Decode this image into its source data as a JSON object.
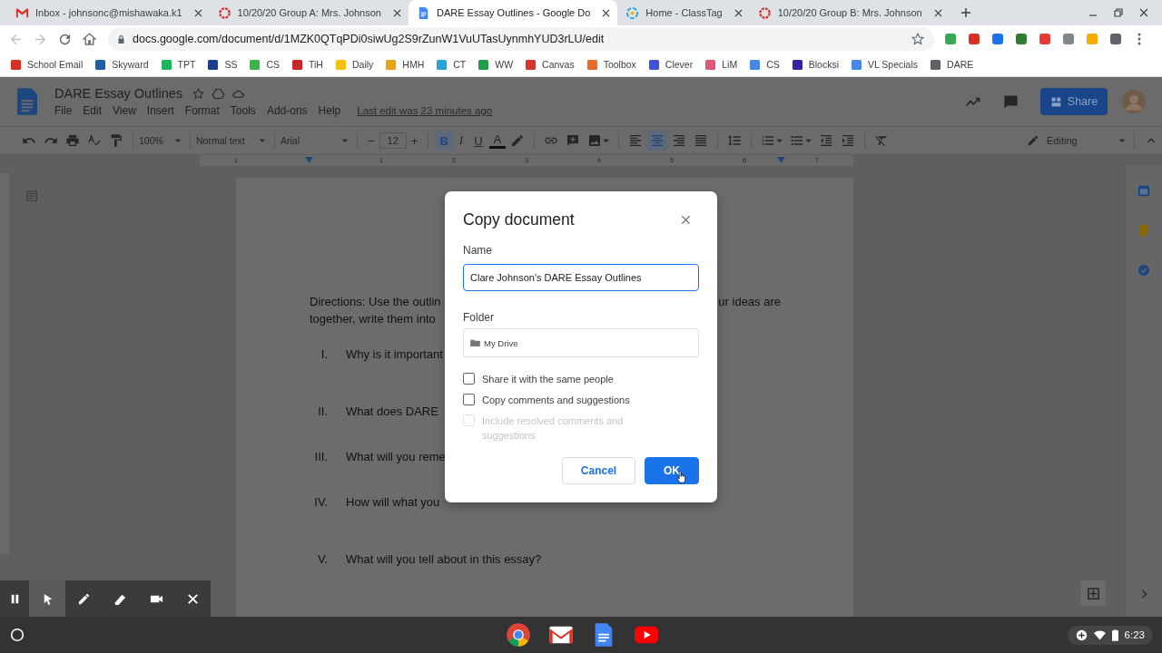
{
  "browser": {
    "tabs": [
      {
        "title": "Inbox - johnsonc@mishawaka.k1",
        "kind": "mail",
        "selected": false
      },
      {
        "title": "10/20/20 Group A: Mrs. Johnson",
        "kind": "ring",
        "selected": false
      },
      {
        "title": "DARE Essay Outlines - Google Do",
        "kind": "doc",
        "selected": true
      },
      {
        "title": "Home - ClassTag",
        "kind": "swirl",
        "selected": false
      },
      {
        "title": "10/20/20 Group B: Mrs. Johnson",
        "kind": "ring",
        "selected": false
      }
    ],
    "url": "docs.google.com/document/d/1MZK0QTqPDi0siwUg2S9rZunW1VuUTasUynmhYUD3rLU/edit",
    "bookmarks": [
      {
        "label": "School Email",
        "color": "#d93025"
      },
      {
        "label": "Skyward",
        "color": "#1f5fa8"
      },
      {
        "label": "TPT",
        "color": "#1fb35a"
      },
      {
        "label": "SS",
        "color": "#1a3d8f"
      },
      {
        "label": "CS",
        "color": "#3bb54a"
      },
      {
        "label": "TiH",
        "color": "#c62828"
      },
      {
        "label": "Daily",
        "color": "#f4c20d"
      },
      {
        "label": "HMH",
        "color": "#e8a317"
      },
      {
        "label": "CT",
        "color": "#29a3d8"
      },
      {
        "label": "WW",
        "color": "#1e9e4a"
      },
      {
        "label": "Canvas",
        "color": "#d5342b"
      },
      {
        "label": "Toolbox",
        "color": "#e86b2a"
      },
      {
        "label": "Clever",
        "color": "#4054d6"
      },
      {
        "label": "LiM",
        "color": "#e0577a"
      },
      {
        "label": "CS",
        "color": "#4a86e8"
      },
      {
        "label": "Blocksi",
        "color": "#3c1fa3"
      },
      {
        "label": "VL Specials",
        "color": "#4a86e8"
      },
      {
        "label": "DARE",
        "color": "#5f6368"
      }
    ]
  },
  "docs": {
    "title": "DARE Essay Outlines",
    "menus": [
      "File",
      "Edit",
      "View",
      "Insert",
      "Format",
      "Tools",
      "Add-ons",
      "Help"
    ],
    "last_edit": "Last edit was 23 minutes ago",
    "share": "Share",
    "toolbar": {
      "zoom": "100%",
      "style": "Normal text",
      "font": "Arial",
      "decrease": "−",
      "size": "12",
      "increase": "+",
      "format": [
        {
          "label": "B",
          "selected": true
        },
        {
          "label": "I",
          "selected": false
        },
        {
          "label": "U",
          "selected": false
        },
        {
          "label": "A",
          "selected": false
        }
      ],
      "align": [
        {
          "kind": "left",
          "selected": false
        },
        {
          "kind": "center",
          "selected": true
        },
        {
          "kind": "right",
          "selected": false
        },
        {
          "kind": "justify",
          "selected": false
        }
      ],
      "mode": "Editing"
    },
    "ruler": [
      "1",
      "1",
      "2",
      "3",
      "4",
      "5",
      "6",
      "7"
    ],
    "document": {
      "directions": [
        {
          "left": "Directions: Use the outlin",
          "right": "ur ideas are"
        },
        {
          "left": "together, write them into"
        }
      ],
      "outline": [
        {
          "numeral": "I.",
          "text": "Why is it important"
        },
        {
          "numeral": "II.",
          "text": "What does DARE"
        },
        {
          "numeral": "III.",
          "text": "What will you reme"
        },
        {
          "numeral": "IV.",
          "text": "How will what you"
        },
        {
          "numeral": "V.",
          "text": "What will you tell about in this essay?"
        }
      ]
    }
  },
  "dialog": {
    "title": "Copy document",
    "name_label": "Name",
    "name_value": "Clare Johnson's DARE Essay Outlines",
    "folder_label": "Folder",
    "folder": "My Drive",
    "options": [
      {
        "label": "Share it with the same people",
        "checked": false,
        "disabled": false
      },
      {
        "label": "Copy comments and suggestions",
        "checked": false,
        "disabled": false
      },
      {
        "label": "Include resolved comments and suggestions",
        "checked": false,
        "disabled": true
      }
    ],
    "buttons": [
      {
        "label": "Cancel",
        "kind": "secondary"
      },
      {
        "label": "OK",
        "kind": "primary"
      }
    ]
  },
  "recorder": {
    "tools": [
      {
        "kind": "pause",
        "selected": false
      },
      {
        "kind": "pointer",
        "selected": true
      },
      {
        "kind": "pen",
        "selected": false
      },
      {
        "kind": "marker",
        "selected": false
      },
      {
        "kind": "camera",
        "selected": false
      },
      {
        "kind": "close",
        "selected": false
      }
    ]
  },
  "shelf": {
    "time": "6:23"
  }
}
